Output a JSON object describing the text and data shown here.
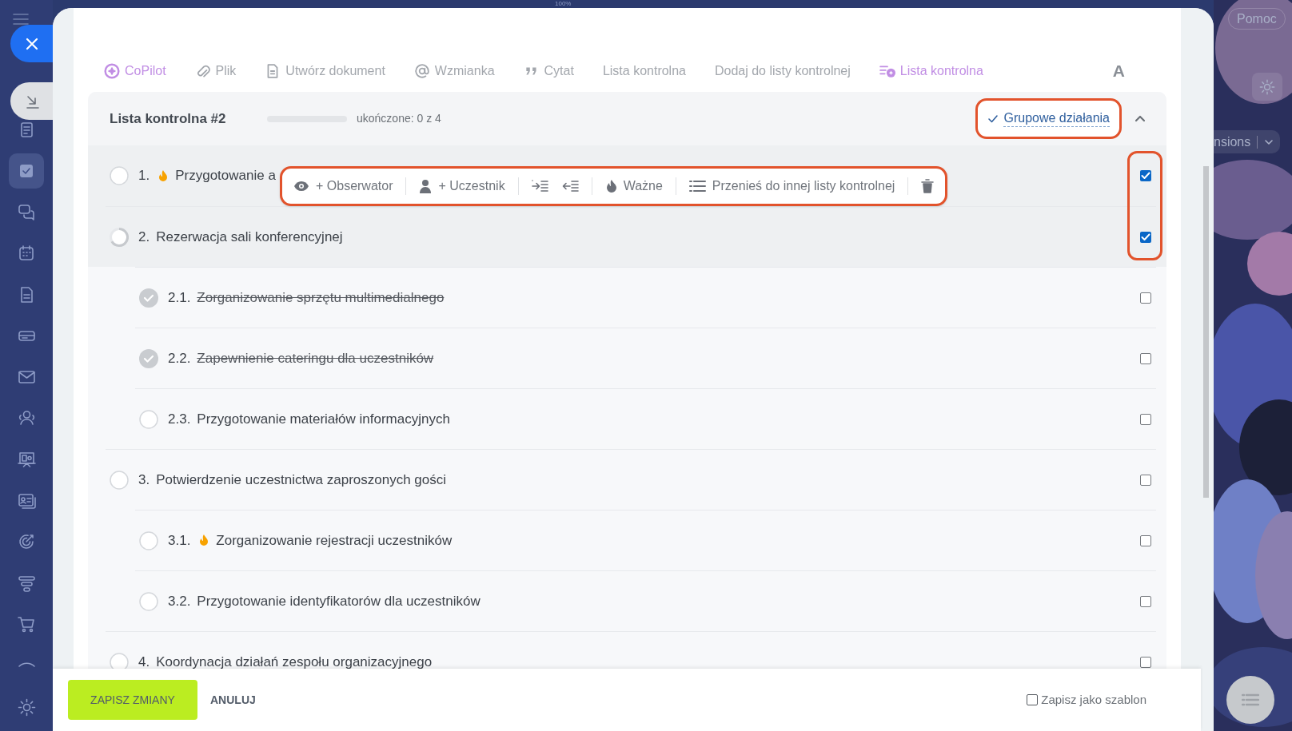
{
  "zoom_label": "100%",
  "sidebar": {
    "items": [
      {
        "kind": "feed",
        "selected": false
      },
      {
        "kind": "tasks",
        "selected": true
      },
      {
        "kind": "chat",
        "selected": false
      },
      {
        "kind": "calendar",
        "selected": false
      },
      {
        "kind": "document",
        "selected": false
      },
      {
        "kind": "drive",
        "selected": false
      },
      {
        "kind": "mail",
        "selected": false
      },
      {
        "kind": "people",
        "selected": false
      },
      {
        "kind": "board",
        "selected": false
      },
      {
        "kind": "contact",
        "selected": false
      },
      {
        "kind": "target",
        "selected": false
      },
      {
        "kind": "funnel",
        "selected": false
      },
      {
        "kind": "cart",
        "selected": false
      },
      {
        "kind": "collapse",
        "selected": false
      },
      {
        "kind": "gear",
        "selected": false
      }
    ]
  },
  "toolbar": [
    {
      "kind": "copilot",
      "label": "CoPilot",
      "highlighted": true
    },
    {
      "kind": "file",
      "label": "Plik",
      "highlighted": false
    },
    {
      "kind": "document",
      "label": "Utwórz dokument",
      "highlighted": false
    },
    {
      "kind": "mention",
      "label": "Wzmianka",
      "highlighted": false
    },
    {
      "kind": "quote",
      "label": "Cytat",
      "highlighted": false
    },
    {
      "kind": "plain",
      "label": "Lista kontrolna",
      "highlighted": false
    },
    {
      "kind": "plain",
      "label": "Dodaj do listy kontrolnej",
      "highlighted": false
    },
    {
      "kind": "checklist",
      "label": "Lista kontrolna",
      "highlighted": true
    },
    {
      "kind": "font",
      "label": "A",
      "highlighted": false
    }
  ],
  "checklist": {
    "title": "Lista kontrolna #2",
    "progress": {
      "level": 0,
      "label": "ukończone: 0 z 4"
    },
    "group_actions": {
      "label": "Grupowe działania",
      "on": true
    },
    "expanded": true,
    "items": [
      {
        "number": "1.",
        "text": "Przygotowanie a",
        "done": false,
        "important": true,
        "selected": true
      },
      {
        "number": "2.",
        "text": "Rezerwacja sali konferencyjnej",
        "done": false,
        "in_progress": true,
        "important": false,
        "selected": true,
        "children": [
          {
            "number": "2.1.",
            "text": "Zorganizowanie sprzętu multimedialnego",
            "done": true,
            "important": false,
            "selected": false
          },
          {
            "number": "2.2.",
            "text": "Zapewnienie cateringu dla uczestników",
            "done": true,
            "important": false,
            "selected": false
          },
          {
            "number": "2.3.",
            "text": "Przygotowanie materiałów informacyjnych",
            "done": false,
            "important": false,
            "selected": false
          }
        ]
      },
      {
        "number": "3.",
        "text": "Potwierdzenie uczestnictwa zaproszonych gości",
        "done": false,
        "important": false,
        "selected": false,
        "children": [
          {
            "number": "3.1.",
            "text": "Zorganizowanie rejestracji uczestników",
            "done": false,
            "important": true,
            "selected": false
          },
          {
            "number": "3.2.",
            "text": "Przygotowanie identyfikatorów dla uczestników",
            "done": false,
            "important": false,
            "selected": false
          }
        ]
      },
      {
        "number": "4.",
        "text": "Koordynacja działań zespołu organizacyjnego",
        "done": false,
        "important": false,
        "selected": false
      }
    ],
    "item_actions": [
      {
        "kind": "observer",
        "label": "+ Obserwator"
      },
      {
        "kind": "participant",
        "label": "+ Uczestnik"
      },
      {
        "kind": "indent"
      },
      {
        "kind": "outdent"
      },
      {
        "kind": "important",
        "label": "Ważne"
      },
      {
        "kind": "move",
        "label": "Przenieś do innej listy kontrolnej"
      },
      {
        "kind": "delete"
      }
    ]
  },
  "footer": {
    "save": "ZAPISZ ZMIANY",
    "cancel": "ANULUJ",
    "template": {
      "label": "Zapisz jako szablon",
      "checked": false
    }
  },
  "right_panel": {
    "help": "Pomoc",
    "dropdown": "nsions"
  }
}
